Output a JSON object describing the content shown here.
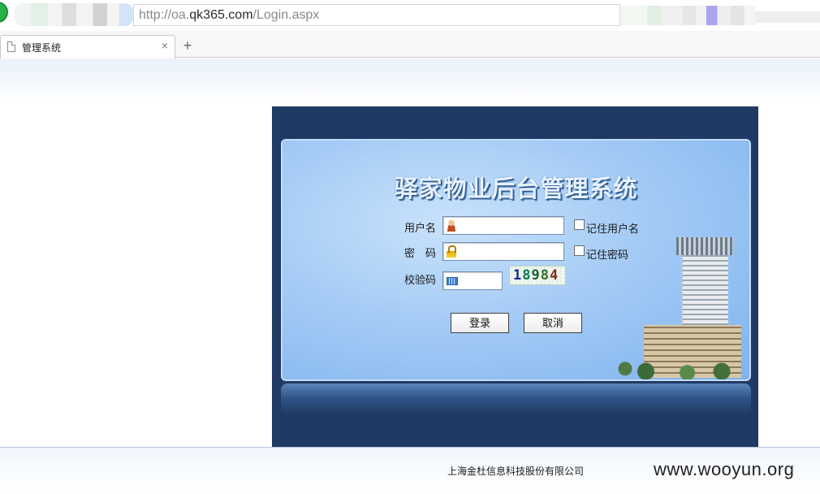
{
  "browser": {
    "url_prefix": "http://oa.",
    "url_host": "qk365.com",
    "url_path": "/Login.aspx",
    "tab_title": "管理系统",
    "tab_close": "×",
    "new_tab": "+"
  },
  "login": {
    "title": "驿家物业后台管理系统",
    "username_label": "用户名",
    "username_value": "",
    "remember_user_label": "记住用户名",
    "password_label": "密　码",
    "password_value": "",
    "remember_pwd_label": "记住密码",
    "captcha_label": "校验码",
    "captcha_value": "",
    "captcha_code": [
      "1",
      "8",
      "9",
      "8",
      "4"
    ],
    "login_button": "登录",
    "cancel_button": "取消"
  },
  "footer": {
    "copyright": "上海金杜信息科技股份有限公司",
    "watermark": "www.wooyun.org"
  },
  "colors": {
    "frame": "#1f3a63",
    "panel": "#a4cbf5",
    "title_shadow": "#2f5d93"
  }
}
